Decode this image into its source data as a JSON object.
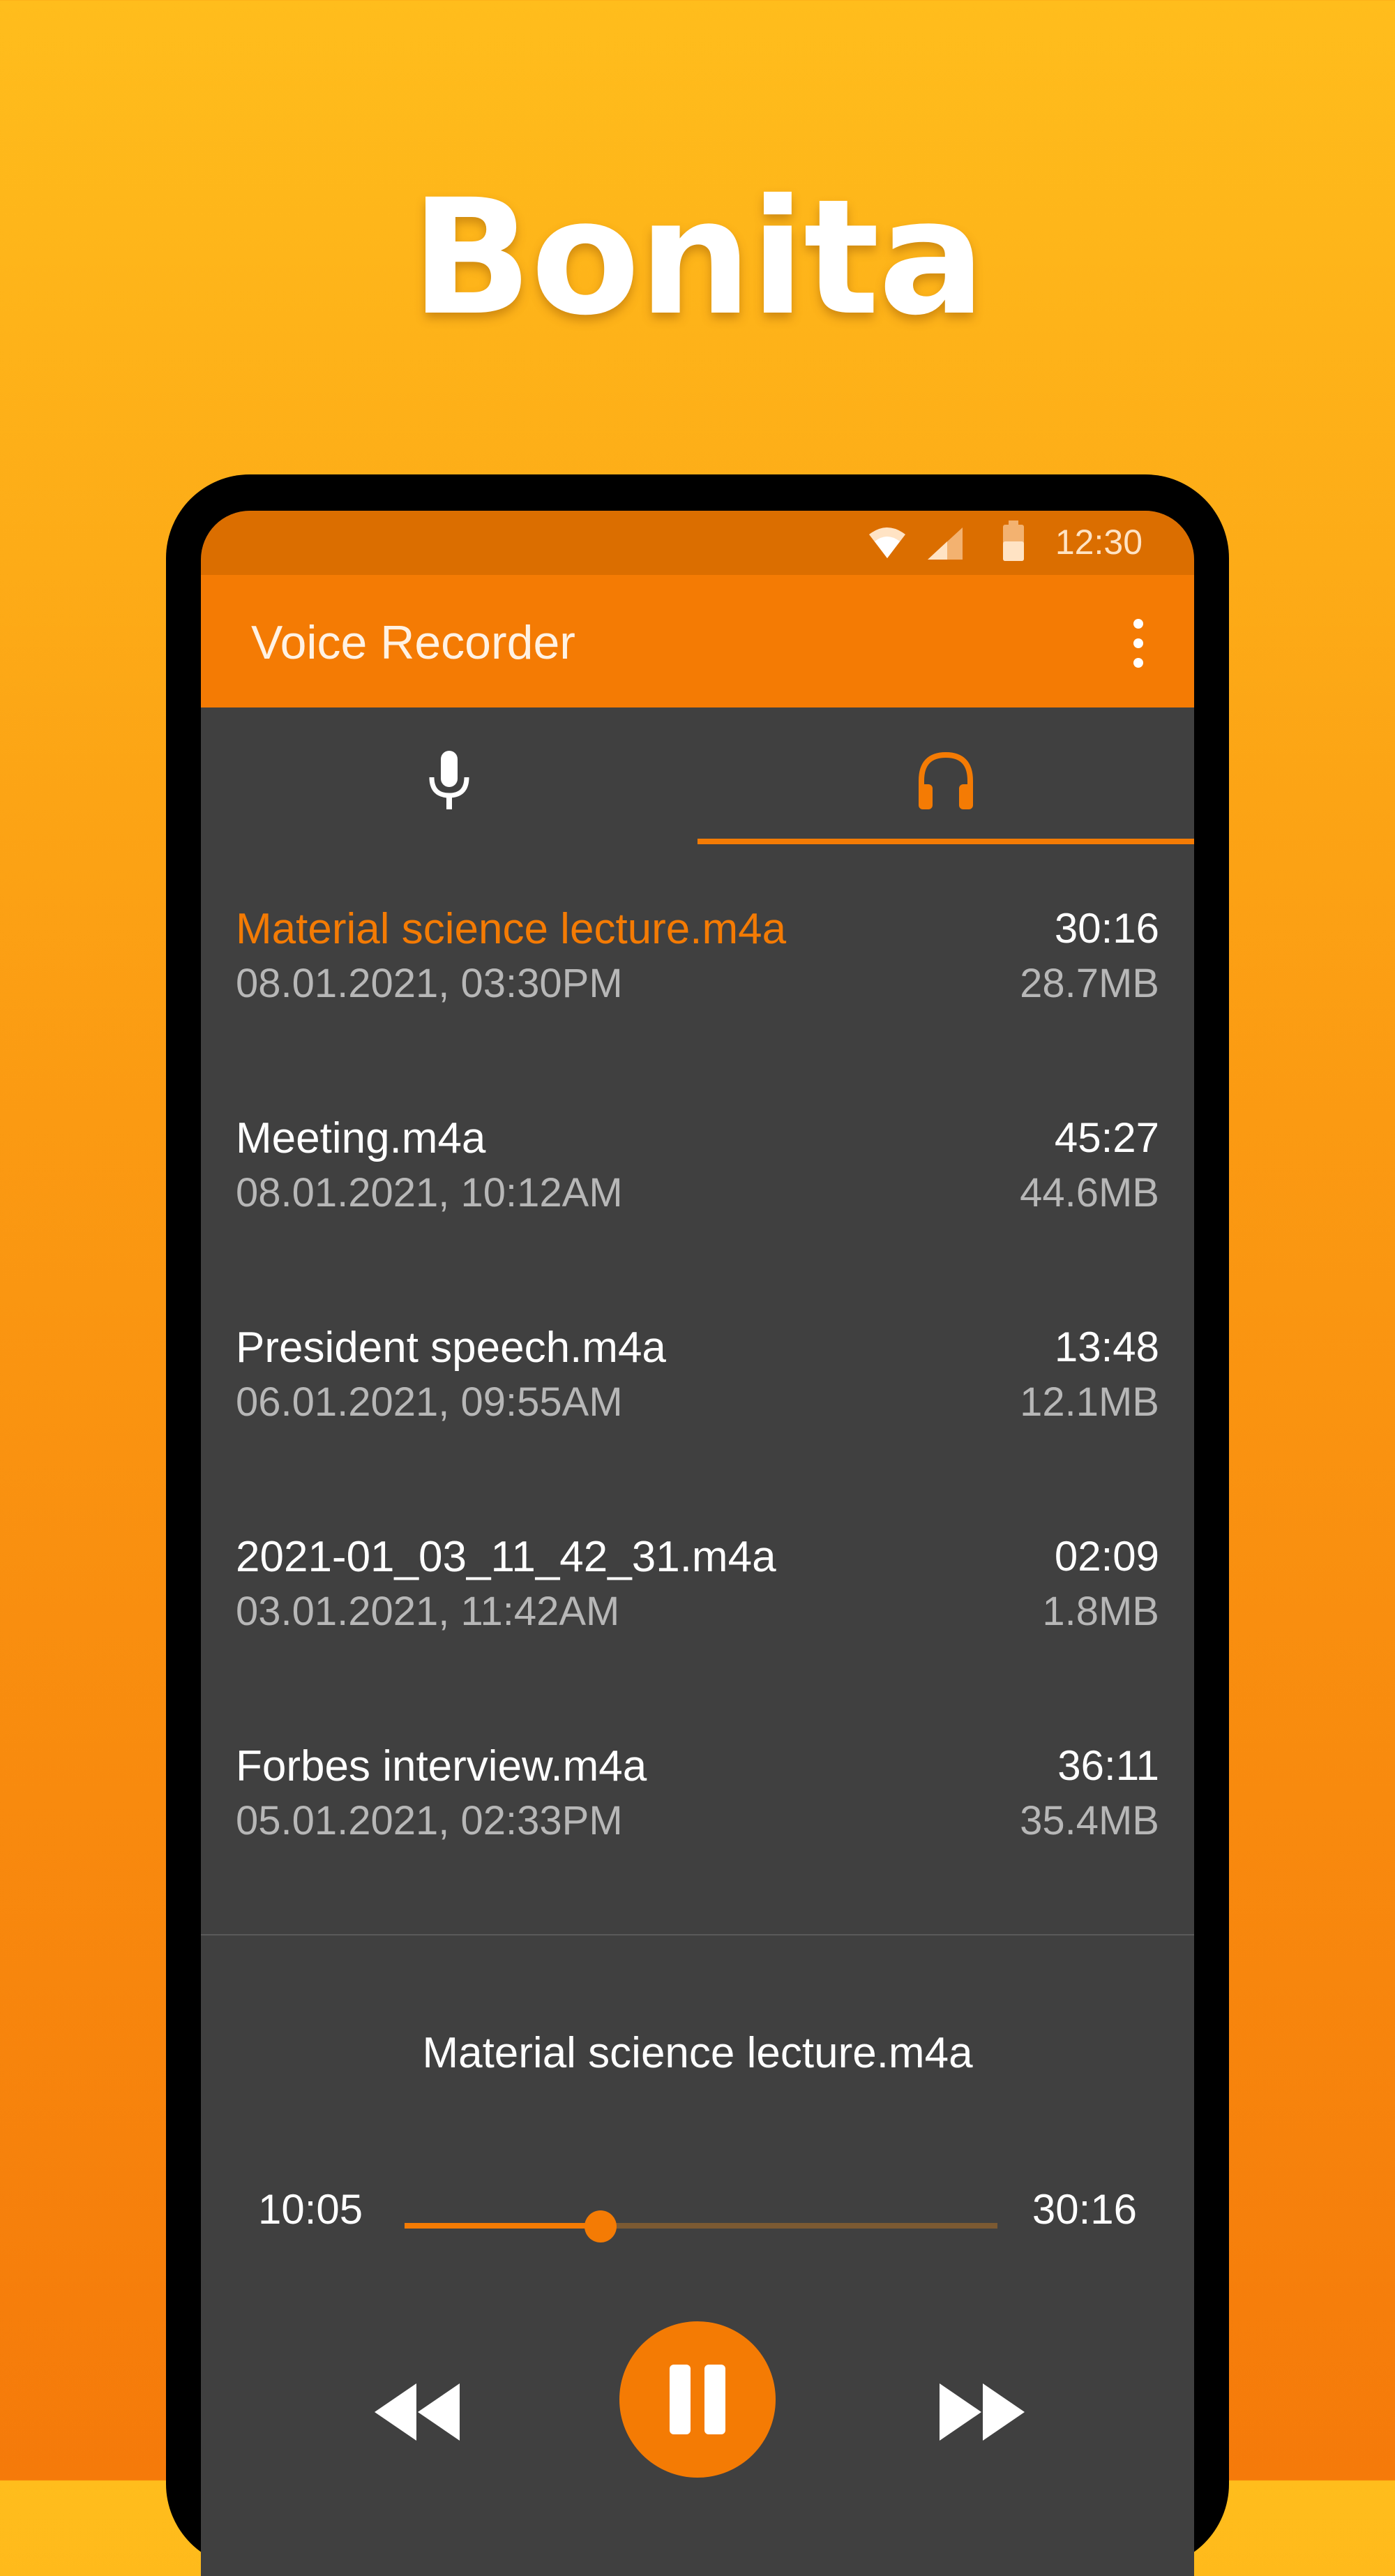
{
  "hero": {
    "title": "Bonita"
  },
  "status_bar": {
    "time": "12:30"
  },
  "app_bar": {
    "title": "Voice Recorder",
    "menu_icon": "more-vert-icon"
  },
  "tabs": [
    {
      "icon": "microphone-icon",
      "selected": false
    },
    {
      "icon": "headphones-icon",
      "selected": true
    }
  ],
  "recordings": [
    {
      "name": "Material science lecture.m4a",
      "date": "08.01.2021, 03:30PM",
      "duration": "30:16",
      "size": "28.7MB",
      "active": true
    },
    {
      "name": "Meeting.m4a",
      "date": "08.01.2021, 10:12AM",
      "duration": "45:27",
      "size": "44.6MB",
      "active": false
    },
    {
      "name": "President speech.m4a",
      "date": "06.01.2021, 09:55AM",
      "duration": "13:48",
      "size": "12.1MB",
      "active": false
    },
    {
      "name": "2021-01_03_11_42_31.m4a",
      "date": "03.01.2021, 11:42AM",
      "duration": "02:09",
      "size": "1.8MB",
      "active": false
    },
    {
      "name": "Forbes interview.m4a",
      "date": "05.01.2021, 02:33PM",
      "duration": "36:11",
      "size": "35.4MB",
      "active": false
    }
  ],
  "player": {
    "title": "Material science lecture.m4a",
    "current_time": "10:05",
    "total_time": "30:16",
    "progress": 0.33
  },
  "colors": {
    "accent": "#f47b04",
    "status_bar": "#db6e00",
    "background": "#404040"
  }
}
